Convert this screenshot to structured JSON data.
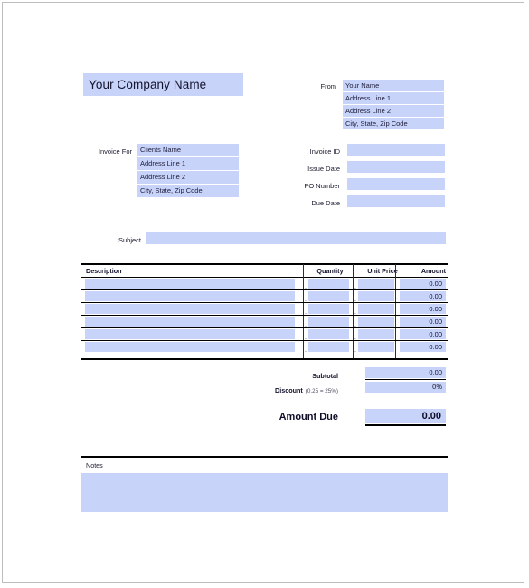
{
  "document": {
    "type": "invoice-template",
    "company_name": "Your Company Name"
  },
  "from": {
    "label": "From",
    "lines": [
      "Your Name",
      "Address Line 1",
      "Address Line 2",
      "City, State, Zip Code"
    ]
  },
  "invoice_for": {
    "label": "Invoice For",
    "lines": [
      "Clients Name",
      "Address Line 1",
      "Address Line 2",
      "City, State, Zip Code"
    ]
  },
  "details": {
    "fields": [
      {
        "label": "Invoice ID",
        "value": ""
      },
      {
        "label": "Issue Date",
        "value": ""
      },
      {
        "label": "PO Number",
        "value": ""
      },
      {
        "label": "Due Date",
        "value": ""
      }
    ]
  },
  "subject": {
    "label": "Subject",
    "value": ""
  },
  "line_items": {
    "columns": [
      "Description",
      "Quantity",
      "Unit Price",
      "Amount"
    ],
    "separator": ".",
    "rows": [
      {
        "description": "",
        "quantity": "",
        "unit_price": "",
        "amount": "0.00"
      },
      {
        "description": "",
        "quantity": "",
        "unit_price": "",
        "amount": "0.00"
      },
      {
        "description": "",
        "quantity": "",
        "unit_price": "",
        "amount": "0.00"
      },
      {
        "description": "",
        "quantity": "",
        "unit_price": "",
        "amount": "0.00"
      },
      {
        "description": "",
        "quantity": "",
        "unit_price": "",
        "amount": "0.00"
      },
      {
        "description": "",
        "quantity": "",
        "unit_price": "",
        "amount": "0.00"
      }
    ]
  },
  "totals": {
    "subtotal_label": "Subtotal",
    "subtotal_value": "0.00",
    "discount_label": "Discount",
    "discount_hint": "(0.25 = 25%)",
    "discount_value": "0%",
    "amount_due_label": "Amount Due",
    "amount_due_value": "0.00"
  },
  "notes": {
    "label": "Notes",
    "value": ""
  },
  "colors": {
    "field_fill": "#c8d3f9",
    "rule": "#000000",
    "page_border": "#bdbdbd",
    "text": "#1a1a2e"
  }
}
